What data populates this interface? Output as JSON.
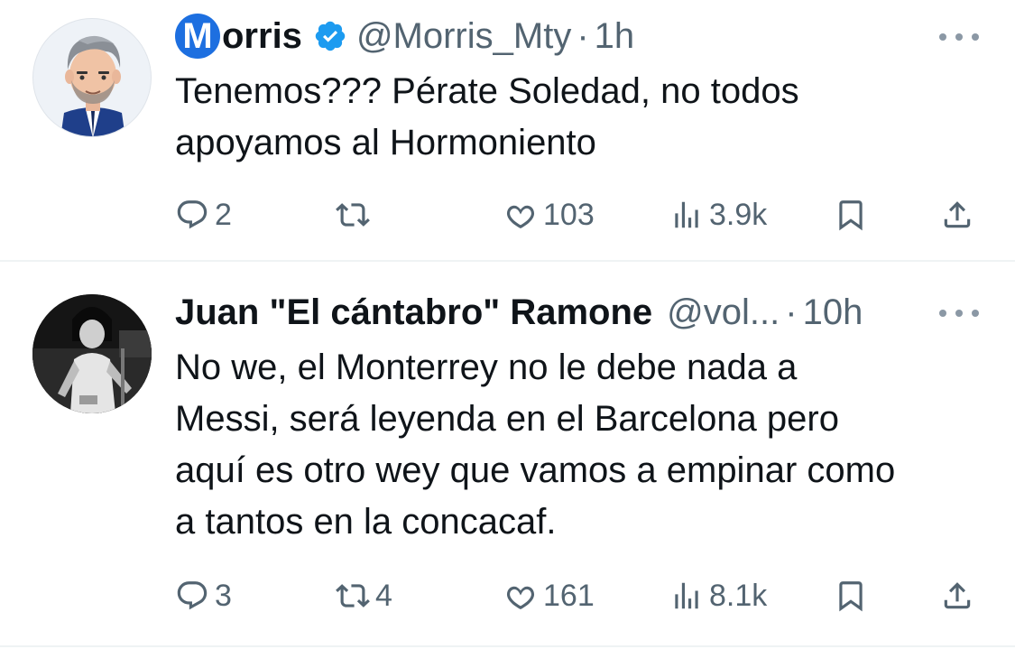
{
  "tweets": [
    {
      "name_rest": "orris",
      "name_logo_letter": "M",
      "verified": true,
      "handle": "@Morris_Mty",
      "dot": "·",
      "time": "1h",
      "text": "Tenemos??? Pérate Soledad, no todos\napoyamos al Hormoniento",
      "replies": "2",
      "reposts": "",
      "likes": "103",
      "views": "3.9k"
    },
    {
      "name": "Juan \"El cántabro\" Ramone",
      "handle": "@vol...",
      "dot": "·",
      "time": "10h",
      "text": "No we, el Monterrey no le debe nada a\nMessi, será leyenda en el Barcelona pero\naquí es otro wey que vamos a empinar como\na tantos en la concacaf.",
      "replies": "3",
      "reposts": "4",
      "likes": "161",
      "views": "8.1k"
    }
  ],
  "colors": {
    "text": "#0f1419",
    "secondary": "#536471",
    "verified": "#1d9bf0",
    "logo": "#1d6fe0",
    "divider": "#eff3f4"
  },
  "icons": [
    "reply-icon",
    "repost-icon",
    "like-icon",
    "views-icon",
    "bookmark-icon",
    "share-icon",
    "more-icon",
    "verified-badge-icon"
  ]
}
